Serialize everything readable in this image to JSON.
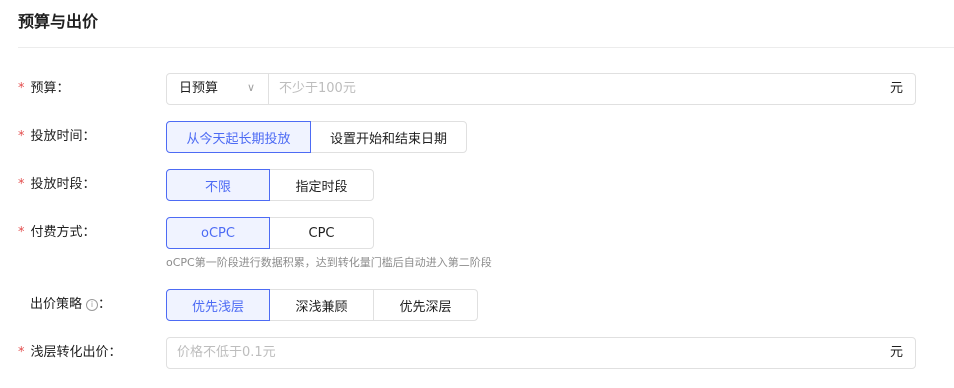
{
  "section": {
    "title": "预算与出价"
  },
  "budget": {
    "label": "预算：",
    "required_mark": "*",
    "select_value": "日预算",
    "select_arrow": "∨",
    "placeholder": "不少于100元",
    "suffix": "元"
  },
  "schedule_time": {
    "label": "投放时间：",
    "required_mark": "*",
    "options": [
      "从今天起长期投放",
      "设置开始和结束日期"
    ],
    "selected_index": 0
  },
  "schedule_period": {
    "label": "投放时段：",
    "required_mark": "*",
    "options": [
      "不限",
      "指定时段"
    ],
    "selected_index": 0
  },
  "payment": {
    "label": "付费方式：",
    "required_mark": "*",
    "options": [
      "oCPC",
      "CPC"
    ],
    "selected_index": 0,
    "hint": "oCPC第一阶段进行数据积累，达到转化量门槛后自动进入第二阶段"
  },
  "bid_strategy": {
    "label": "出价策略",
    "label_colon": "：",
    "info_glyph": "i",
    "options": [
      "优先浅层",
      "深浅兼顾",
      "优先深层"
    ],
    "selected_index": 0
  },
  "shallow_bid": {
    "label": "浅层转化出价：",
    "required_mark": "*",
    "placeholder": "价格不低于0.1元",
    "suffix": "元"
  },
  "colors": {
    "accent": "#4d6bf4",
    "required": "#e34d4d",
    "border": "#e0e0e0"
  }
}
